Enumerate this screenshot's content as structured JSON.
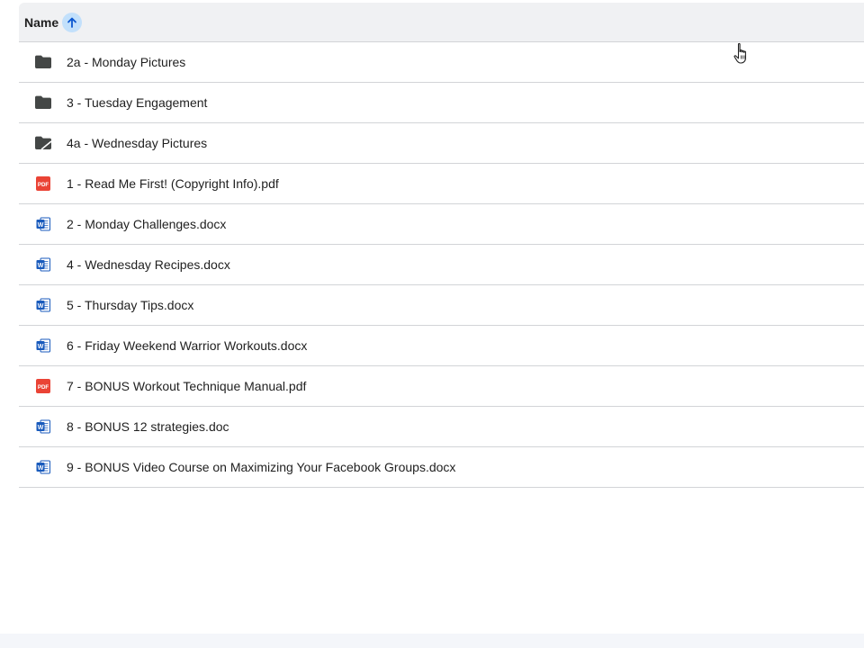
{
  "header": {
    "column_label": "Name",
    "sort_icon": "arrow-up-icon"
  },
  "colors": {
    "header_bg": "#f0f1f3",
    "sort_highlight": "#c2e0fb",
    "sort_arrow": "#0b57d0",
    "folder": "#444746",
    "pdf": "#ea4335",
    "word": "#185abc",
    "divider": "#d2d4d7"
  },
  "files": [
    {
      "name": "2a - Monday Pictures",
      "icon": "folder-icon",
      "type": "folder"
    },
    {
      "name": "3 - Tuesday Engagement",
      "icon": "folder-icon",
      "type": "folder"
    },
    {
      "name": "4a - Wednesday Pictures",
      "icon": "shared-folder-icon",
      "type": "shared-folder"
    },
    {
      "name": "1 - Read Me First! (Copyright Info).pdf",
      "icon": "pdf-icon",
      "type": "pdf"
    },
    {
      "name": "2 - Monday Challenges.docx",
      "icon": "word-doc-icon",
      "type": "docx"
    },
    {
      "name": "4 - Wednesday Recipes.docx",
      "icon": "word-doc-icon",
      "type": "docx"
    },
    {
      "name": "5 - Thursday Tips.docx",
      "icon": "word-doc-icon",
      "type": "docx"
    },
    {
      "name": "6 - Friday Weekend Warrior Workouts.docx",
      "icon": "word-doc-icon",
      "type": "docx"
    },
    {
      "name": "7 - BONUS Workout Technique Manual.pdf",
      "icon": "pdf-icon",
      "type": "pdf"
    },
    {
      "name": "8 - BONUS 12 strategies.doc",
      "icon": "word-doc-icon",
      "type": "docx"
    },
    {
      "name": "9 - BONUS Video Course on Maximizing Your Facebook Groups.docx",
      "icon": "word-doc-icon",
      "type": "docx"
    }
  ],
  "pdf_badge_text": "PDF",
  "word_badge_text": "W",
  "cursor_icon": "hand-pointer-icon"
}
